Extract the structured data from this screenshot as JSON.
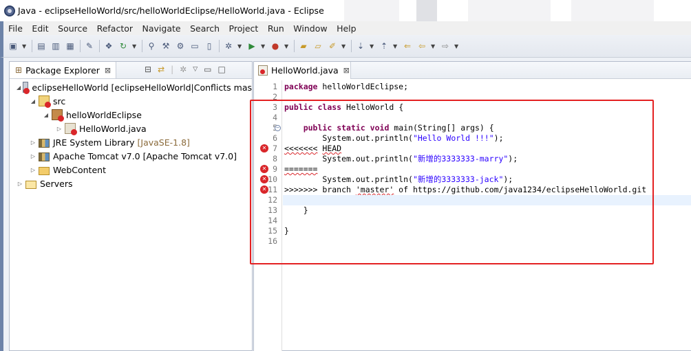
{
  "window": {
    "title": "Java - eclipseHelloWorld/src/helloWorldEclipse/HelloWorld.java - Eclipse"
  },
  "menu": [
    "File",
    "Edit",
    "Source",
    "Refactor",
    "Navigate",
    "Search",
    "Project",
    "Run",
    "Window",
    "Help"
  ],
  "toolbar": {
    "icons": [
      "new-icon",
      "save-icon",
      "save-all-icon",
      "print-icon",
      "toggle-mark-icon",
      "new-package-icon",
      "refresh-icon",
      "debug-icon",
      "search-icon",
      "open-type-icon",
      "open-task-icon",
      "run-last-icon",
      "run-icon",
      "external-tools-icon",
      "open-folder-icon",
      "open-file-icon",
      "pen-icon",
      "next-annotation-icon",
      "prev-annotation-icon",
      "last-edit-icon",
      "back-icon",
      "forward-icon"
    ]
  },
  "package_explorer": {
    "tab_label": "Package Explorer",
    "close_glyph": "⊠",
    "tree": [
      {
        "name": "eclipseHelloWorld",
        "suffix": " [eclipseHelloWorld|Conflicts mas",
        "depth": 0,
        "expanded": true,
        "icon": "project-error-icon"
      },
      {
        "name": "src",
        "depth": 1,
        "expanded": true,
        "icon": "source-folder-error-icon"
      },
      {
        "name": "helloWorldEclipse",
        "depth": 2,
        "expanded": true,
        "icon": "package-error-icon"
      },
      {
        "name": "HelloWorld.java",
        "depth": 3,
        "expanded": false,
        "icon": "java-file-error-icon"
      },
      {
        "name": "JRE System Library",
        "suffix": " [JavaSE-1.8]",
        "depth": 1,
        "expanded": false,
        "icon": "library-icon"
      },
      {
        "name": "Apache Tomcat v7.0 [Apache Tomcat v7.0]",
        "depth": 1,
        "expanded": false,
        "icon": "library-icon"
      },
      {
        "name": "WebContent",
        "depth": 1,
        "expanded": false,
        "icon": "folder-icon"
      },
      {
        "name": "Servers",
        "depth": 0,
        "expanded": false,
        "icon": "folder-open-icon"
      }
    ]
  },
  "editor": {
    "tab_label": "HelloWorld.java",
    "close_glyph": "⊠",
    "current_line": 12,
    "lines": [
      {
        "n": "1",
        "text": "package helloWorldEclipse;"
      },
      {
        "n": "2",
        "text": ""
      },
      {
        "n": "3",
        "text": "public class HelloWorld {"
      },
      {
        "n": "4",
        "text": ""
      },
      {
        "n": "5",
        "text": "    public static void main(String[] args) {",
        "fold": true
      },
      {
        "n": "6",
        "text": "        System.out.println(\"Hello World !!!\");"
      },
      {
        "n": "7",
        "text": "<<<<<<< HEAD",
        "error": true
      },
      {
        "n": "8",
        "text": "        System.out.println(\"新增的3333333-marry\");"
      },
      {
        "n": "9",
        "text": "=======",
        "error": true
      },
      {
        "n": "10",
        "text": "        System.out.println(\"新增的3333333-jack\");",
        "error": true
      },
      {
        "n": "11",
        "text": ">>>>>>> branch 'master' of https://github.com/java1234/eclipseHelloWorld.git",
        "error": true
      },
      {
        "n": "12",
        "text": ""
      },
      {
        "n": "13",
        "text": "    }"
      },
      {
        "n": "14",
        "text": ""
      },
      {
        "n": "15",
        "text": "}"
      },
      {
        "n": "16",
        "text": ""
      }
    ]
  },
  "colors": {
    "annotation_box": "#e42021",
    "keyword": "#7f0055",
    "string": "#2a00ff",
    "error": "#d9262a"
  }
}
